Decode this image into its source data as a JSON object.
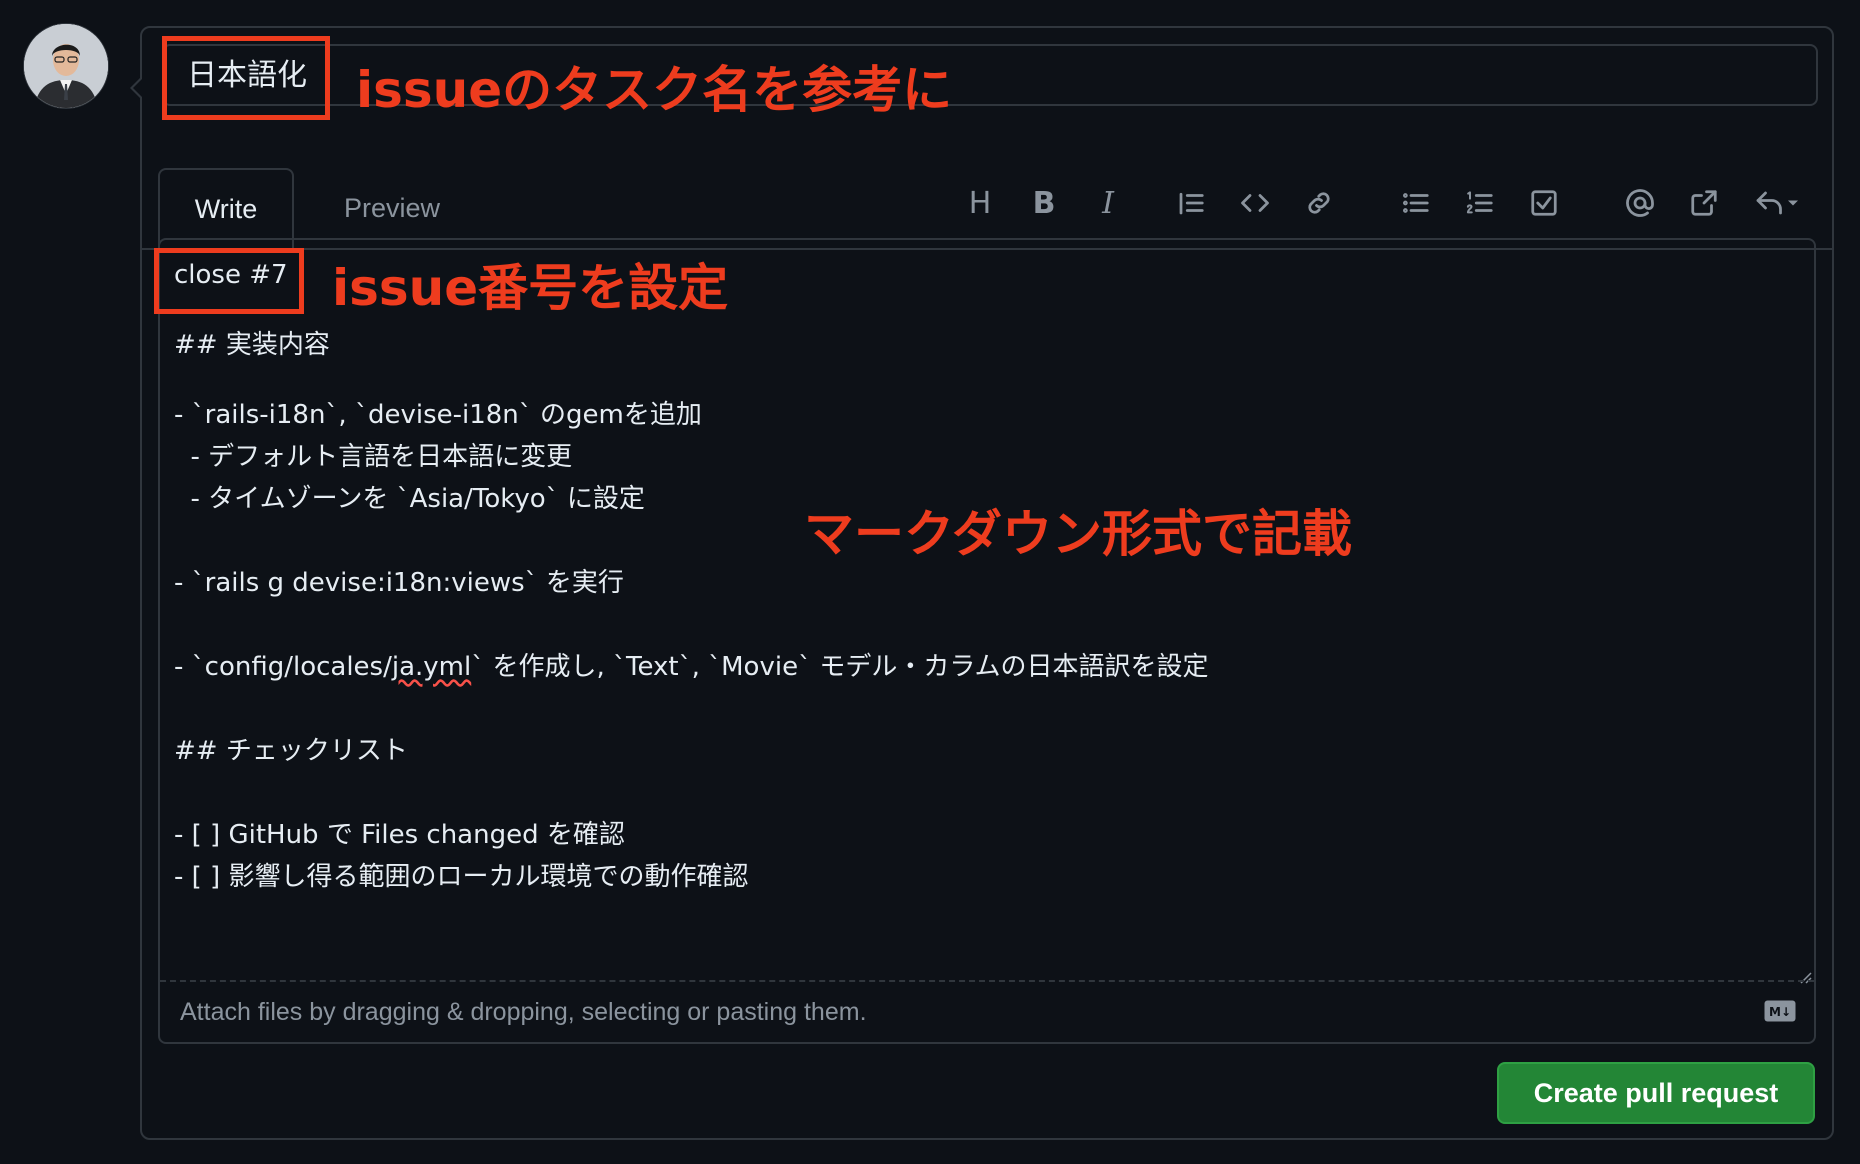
{
  "pr_form": {
    "title_value": "日本語化",
    "tabs": {
      "write": "Write",
      "preview": "Preview"
    },
    "toolbar": {
      "heading": "H",
      "bold": "B",
      "italic": "I"
    },
    "body_lines": [
      "close #7",
      "## 実装内容",
      "- `rails-i18n`, `devise-i18n` のgemを追加",
      "  - デフォルト言語を日本語に変更",
      "  - タイムゾーンを `Asia/Tokyo` に設定",
      "- `rails g devise:i18n:views` を実行",
      "- `config/locales/",
      "ja.yml",
      "` を作成し, `Text`, `Movie` モデル・カラムの日本語訳を設定",
      "## チェックリスト",
      "- [ ] GitHub で Files changed を確認",
      "- [ ] 影響し得る範囲のローカル環境での動作確認"
    ],
    "attach_hint": "Attach files by dragging & dropping, selecting or pasting them.",
    "markdown_badge": "M↓",
    "submit_label": "Create pull request"
  },
  "annotations": {
    "title_note": "issueのタスク名を参考に",
    "issue_note": "issue番号を設定",
    "markdown_note": "マークダウン形式で記載"
  },
  "colors": {
    "background": "#0d1117",
    "border": "#30363d",
    "annotation": "#ee3c1e",
    "primary_button": "#238636",
    "muted_text": "#8b949e"
  }
}
